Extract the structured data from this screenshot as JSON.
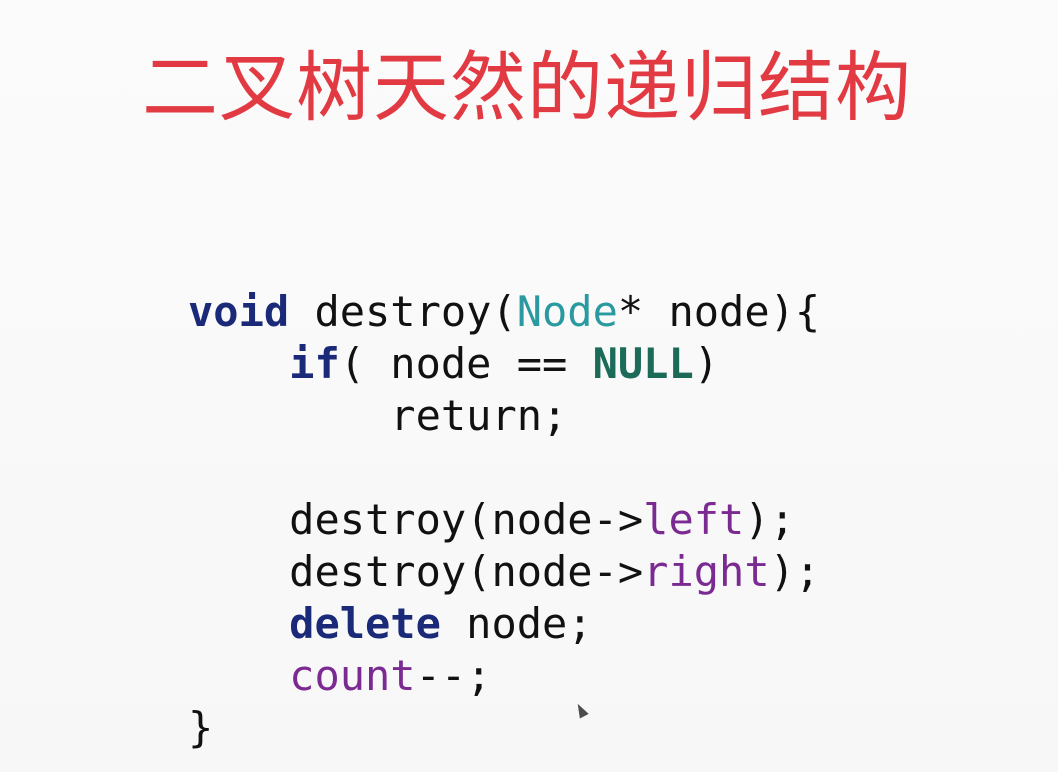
{
  "slide": {
    "title": "二叉树天然的递归结构",
    "code": {
      "line1": {
        "kw": "void",
        "sp1": " destroy(",
        "type": "Node",
        "rest": "* node){"
      },
      "line2": {
        "indent": "    ",
        "kw": "if",
        "mid": "( node == ",
        "const": "NULL",
        "end": ")"
      },
      "line3": {
        "indent": "        ",
        "text": "return;"
      },
      "line4": {
        "text": ""
      },
      "line5": {
        "indent": "    ",
        "pre": "destroy(node->",
        "field": "left",
        "post": ");"
      },
      "line6": {
        "indent": "    ",
        "pre": "destroy(node->",
        "field": "right",
        "post": ");"
      },
      "line7": {
        "indent": "    ",
        "kw": "delete",
        "post": " node;"
      },
      "line8": {
        "indent": "    ",
        "field": "count",
        "post": "--;"
      },
      "line9": {
        "text": "}"
      }
    }
  },
  "colors": {
    "title": "#e23a43",
    "keyword": "#1b2a78",
    "type": "#2a9aa0",
    "constant": "#1b6b58",
    "field": "#7b2a92"
  }
}
